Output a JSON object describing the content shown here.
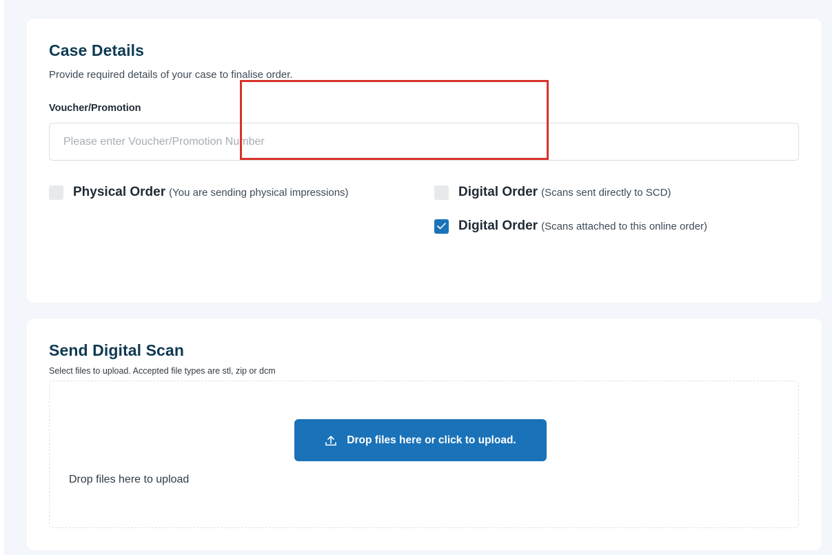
{
  "case_details": {
    "title": "Case Details",
    "subtitle": "Provide required details of your case to finalise order.",
    "voucher": {
      "label": "Voucher/Promotion",
      "value": "",
      "placeholder": "Please enter Voucher/Promotion Number"
    },
    "options": [
      {
        "title": "Physical Order",
        "detail": "(You are sending physical impressions)",
        "checked": false
      },
      {
        "title": "Digital Order",
        "detail": "(Scans sent directly to SCD)",
        "checked": false
      },
      {
        "title": "Digital Order",
        "detail": "(Scans attached to this online order)",
        "checked": true
      }
    ]
  },
  "digital_scan": {
    "title": "Send Digital Scan",
    "subtitle": "Select files to upload. Accepted file types are stl, zip or dcm",
    "dropzone_text": "Drop files here to upload",
    "upload_button_label": "Drop files here or click to upload."
  },
  "colors": {
    "accent": "#1a72b8",
    "title": "#0f3a52",
    "highlight": "#d8322c",
    "background": "#f3f6fa"
  },
  "icons": {
    "checkbox_checked": "check-icon",
    "upload": "upload-icon"
  }
}
